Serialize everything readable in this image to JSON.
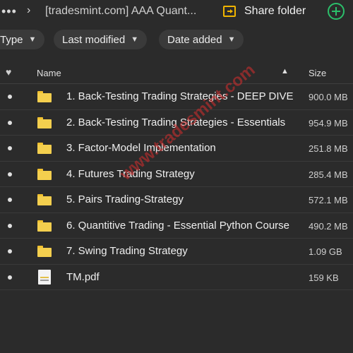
{
  "topbar": {
    "more_glyph": "•••",
    "chevron_glyph": "›",
    "breadcrumb": "[tradesmint.com] AAA Quant...",
    "share_label": "Share folder"
  },
  "filters": {
    "type_label": "Type",
    "modified_label": "Last modified",
    "added_label": "Date added"
  },
  "table": {
    "header": {
      "favorite_glyph": "♥",
      "name": "Name",
      "sort_glyph": "▲",
      "size": "Size"
    },
    "rows": [
      {
        "icon": "folder-icon",
        "name": "1. Back-Testing Trading Strategies - DEEP DIVE",
        "size": "900.0 MB"
      },
      {
        "icon": "folder-icon",
        "name": "2. Back-Testing Trading Strategies - Essentials",
        "size": "954.9 MB"
      },
      {
        "icon": "folder-icon",
        "name": "3. Factor-Model Implementation",
        "size": "251.8 MB"
      },
      {
        "icon": "folder-icon",
        "name": "4. Futures Trading Strategy",
        "size": "285.4 MB"
      },
      {
        "icon": "folder-icon",
        "name": "5. Pairs Trading-Strategy",
        "size": "572.1 MB"
      },
      {
        "icon": "folder-icon",
        "name": "6. Quantitive Trading - Essential Python Course",
        "size": "490.2 MB"
      },
      {
        "icon": "folder-icon",
        "name": "7. Swing Trading Strategy",
        "size": "1.09 GB"
      },
      {
        "icon": "pdf-file-icon",
        "name": "TM.pdf",
        "size": "159 KB"
      }
    ]
  },
  "watermark": "www.tradesmint.com",
  "colors": {
    "background": "#2b2b2b",
    "folder": "#f4cf4e",
    "accent_yellow": "#f0b400",
    "add_green": "#2bbf6a",
    "watermark": "#d72d2d"
  }
}
